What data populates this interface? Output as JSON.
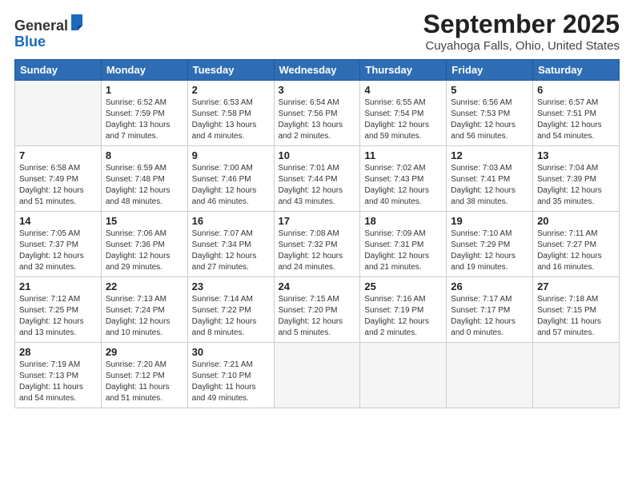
{
  "logo": {
    "general": "General",
    "blue": "Blue"
  },
  "title": "September 2025",
  "subtitle": "Cuyahoga Falls, Ohio, United States",
  "days_of_week": [
    "Sunday",
    "Monday",
    "Tuesday",
    "Wednesday",
    "Thursday",
    "Friday",
    "Saturday"
  ],
  "weeks": [
    [
      {
        "day": "",
        "info": ""
      },
      {
        "day": "1",
        "info": "Sunrise: 6:52 AM\nSunset: 7:59 PM\nDaylight: 13 hours\nand 7 minutes."
      },
      {
        "day": "2",
        "info": "Sunrise: 6:53 AM\nSunset: 7:58 PM\nDaylight: 13 hours\nand 4 minutes."
      },
      {
        "day": "3",
        "info": "Sunrise: 6:54 AM\nSunset: 7:56 PM\nDaylight: 13 hours\nand 2 minutes."
      },
      {
        "day": "4",
        "info": "Sunrise: 6:55 AM\nSunset: 7:54 PM\nDaylight: 12 hours\nand 59 minutes."
      },
      {
        "day": "5",
        "info": "Sunrise: 6:56 AM\nSunset: 7:53 PM\nDaylight: 12 hours\nand 56 minutes."
      },
      {
        "day": "6",
        "info": "Sunrise: 6:57 AM\nSunset: 7:51 PM\nDaylight: 12 hours\nand 54 minutes."
      }
    ],
    [
      {
        "day": "7",
        "info": "Sunrise: 6:58 AM\nSunset: 7:49 PM\nDaylight: 12 hours\nand 51 minutes."
      },
      {
        "day": "8",
        "info": "Sunrise: 6:59 AM\nSunset: 7:48 PM\nDaylight: 12 hours\nand 48 minutes."
      },
      {
        "day": "9",
        "info": "Sunrise: 7:00 AM\nSunset: 7:46 PM\nDaylight: 12 hours\nand 46 minutes."
      },
      {
        "day": "10",
        "info": "Sunrise: 7:01 AM\nSunset: 7:44 PM\nDaylight: 12 hours\nand 43 minutes."
      },
      {
        "day": "11",
        "info": "Sunrise: 7:02 AM\nSunset: 7:43 PM\nDaylight: 12 hours\nand 40 minutes."
      },
      {
        "day": "12",
        "info": "Sunrise: 7:03 AM\nSunset: 7:41 PM\nDaylight: 12 hours\nand 38 minutes."
      },
      {
        "day": "13",
        "info": "Sunrise: 7:04 AM\nSunset: 7:39 PM\nDaylight: 12 hours\nand 35 minutes."
      }
    ],
    [
      {
        "day": "14",
        "info": "Sunrise: 7:05 AM\nSunset: 7:37 PM\nDaylight: 12 hours\nand 32 minutes."
      },
      {
        "day": "15",
        "info": "Sunrise: 7:06 AM\nSunset: 7:36 PM\nDaylight: 12 hours\nand 29 minutes."
      },
      {
        "day": "16",
        "info": "Sunrise: 7:07 AM\nSunset: 7:34 PM\nDaylight: 12 hours\nand 27 minutes."
      },
      {
        "day": "17",
        "info": "Sunrise: 7:08 AM\nSunset: 7:32 PM\nDaylight: 12 hours\nand 24 minutes."
      },
      {
        "day": "18",
        "info": "Sunrise: 7:09 AM\nSunset: 7:31 PM\nDaylight: 12 hours\nand 21 minutes."
      },
      {
        "day": "19",
        "info": "Sunrise: 7:10 AM\nSunset: 7:29 PM\nDaylight: 12 hours\nand 19 minutes."
      },
      {
        "day": "20",
        "info": "Sunrise: 7:11 AM\nSunset: 7:27 PM\nDaylight: 12 hours\nand 16 minutes."
      }
    ],
    [
      {
        "day": "21",
        "info": "Sunrise: 7:12 AM\nSunset: 7:25 PM\nDaylight: 12 hours\nand 13 minutes."
      },
      {
        "day": "22",
        "info": "Sunrise: 7:13 AM\nSunset: 7:24 PM\nDaylight: 12 hours\nand 10 minutes."
      },
      {
        "day": "23",
        "info": "Sunrise: 7:14 AM\nSunset: 7:22 PM\nDaylight: 12 hours\nand 8 minutes."
      },
      {
        "day": "24",
        "info": "Sunrise: 7:15 AM\nSunset: 7:20 PM\nDaylight: 12 hours\nand 5 minutes."
      },
      {
        "day": "25",
        "info": "Sunrise: 7:16 AM\nSunset: 7:19 PM\nDaylight: 12 hours\nand 2 minutes."
      },
      {
        "day": "26",
        "info": "Sunrise: 7:17 AM\nSunset: 7:17 PM\nDaylight: 12 hours\nand 0 minutes."
      },
      {
        "day": "27",
        "info": "Sunrise: 7:18 AM\nSunset: 7:15 PM\nDaylight: 11 hours\nand 57 minutes."
      }
    ],
    [
      {
        "day": "28",
        "info": "Sunrise: 7:19 AM\nSunset: 7:13 PM\nDaylight: 11 hours\nand 54 minutes."
      },
      {
        "day": "29",
        "info": "Sunrise: 7:20 AM\nSunset: 7:12 PM\nDaylight: 11 hours\nand 51 minutes."
      },
      {
        "day": "30",
        "info": "Sunrise: 7:21 AM\nSunset: 7:10 PM\nDaylight: 11 hours\nand 49 minutes."
      },
      {
        "day": "",
        "info": ""
      },
      {
        "day": "",
        "info": ""
      },
      {
        "day": "",
        "info": ""
      },
      {
        "day": "",
        "info": ""
      }
    ]
  ]
}
